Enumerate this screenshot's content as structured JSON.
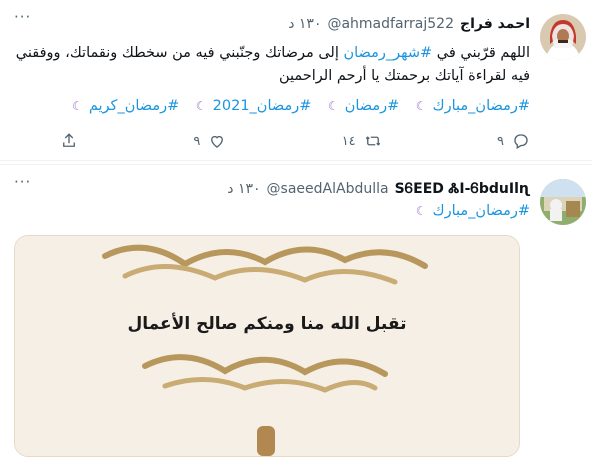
{
  "tweets": [
    {
      "name": "احمد فراج",
      "handle": "@ahmadfarraj522",
      "time": "١٣٠ د",
      "text_prefix": "اللهم قرّبني في ",
      "text_tag": "#شهر_رمضان",
      "text_suffix": " إلى مرضاتك وجنّبني فيه من سخطك ونقماتك، ووفقني فيه لقراءة آياتك برحمتك يا أرحم الراحمين",
      "hashtags": [
        "#رمضان_مبارك",
        "#رمضان",
        "#رمضان_2021",
        "#رمضان_كريم"
      ],
      "actions": {
        "reply": "٩",
        "retweet": "١٤",
        "like": "٩"
      }
    },
    {
      "name": "SᏮEED ᏜI-ᏮbduIlɳ",
      "handle": "@saeedAlAbdulla",
      "time": "١٣٠ د",
      "hashtags": [
        "#رمضان_مبارك"
      ],
      "image": {
        "text": "تقبل الله منا ومنكم صالح الأعمال"
      }
    }
  ],
  "icons": {
    "more": "more-icon",
    "reply": "reply-icon",
    "retweet": "retweet-icon",
    "like": "like-icon",
    "share": "share-icon",
    "moon": "crescent-moon-icon"
  },
  "colors": {
    "link": "#1b95e0",
    "muted": "#536471",
    "moon": "#9b74c8"
  }
}
